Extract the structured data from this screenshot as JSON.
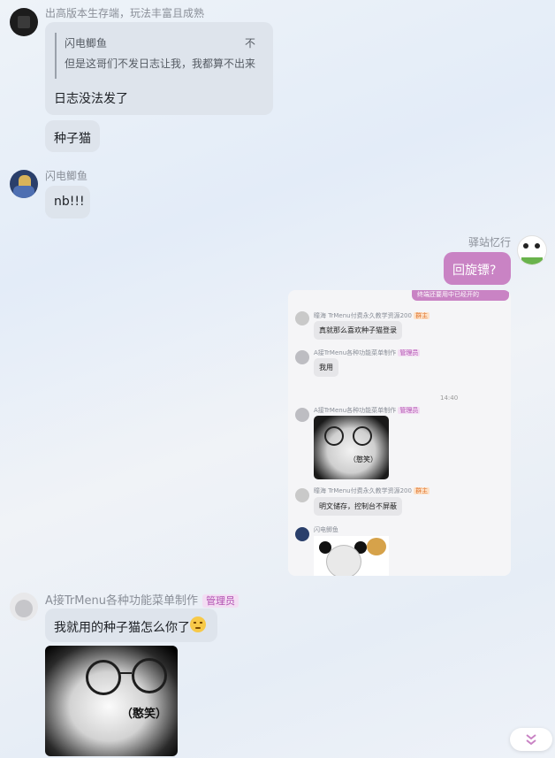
{
  "messages": {
    "m1": {
      "sender": "出高版本生存端，玩法丰富且成熟",
      "reply_name": "闪电鲫鱼",
      "reply_tail": "不",
      "reply_text": "但是这哥们不发日志让我，我都算不出来",
      "text": "日志没法发了"
    },
    "m2": {
      "text": "种子猫"
    },
    "m3": {
      "sender": "闪电鲫鱼",
      "text": "nb!!!"
    },
    "m4": {
      "sender": "驿站忆行",
      "text": "回旋镖?"
    },
    "m5": {
      "sender": "A接TrMenu各种功能菜单制作",
      "badge": "管理员",
      "text": "我就用的种子猫怎么你了",
      "sticker_caption": "（憨笑）"
    }
  },
  "forward": {
    "top_bubble": "终端还要用中已经开的",
    "items": [
      {
        "sender": "瞳海 TrMenu付费永久教学资源200",
        "badge": "群主",
        "text": "真就那么喜欢种子猫登录"
      },
      {
        "sender": "A接TrMenu各种功能菜单制作",
        "badge": "管理员",
        "text": "我用"
      },
      {
        "sender": "A接TrMenu各种功能菜单制作",
        "badge": "管理员",
        "caption": "（憨笑）"
      },
      {
        "sender": "瞳海 TrMenu付费永久教学资源200",
        "badge": "群主",
        "text": "明文储存，控制台不屏蔽"
      },
      {
        "sender": "闪电鲫鱼"
      }
    ],
    "time": "14:40"
  },
  "colors": {
    "accent": "#c983c4",
    "bubble": "#dde3ea",
    "badge_bg": "#f3ddf3",
    "badge_fg": "#b04fb0"
  },
  "icons": {
    "scroll": "double-chevron-down-icon",
    "emoji": "smirk-emoji-icon"
  }
}
